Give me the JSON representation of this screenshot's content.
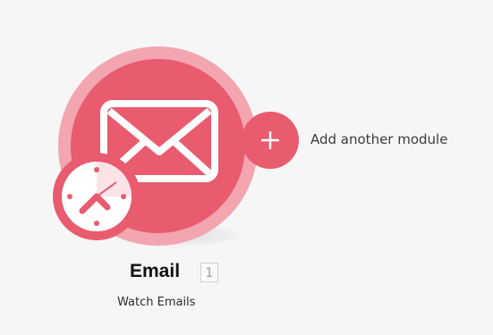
{
  "module": {
    "title": "Email",
    "counter": "1",
    "subtitle": "Watch Emails",
    "icon": "envelope-icon",
    "trigger_icon": "clock-icon",
    "colors": {
      "primary": "#e95b6e",
      "ring": "#f3a5b0"
    }
  },
  "add_module": {
    "label": "Add another module",
    "icon": "plus-icon"
  }
}
